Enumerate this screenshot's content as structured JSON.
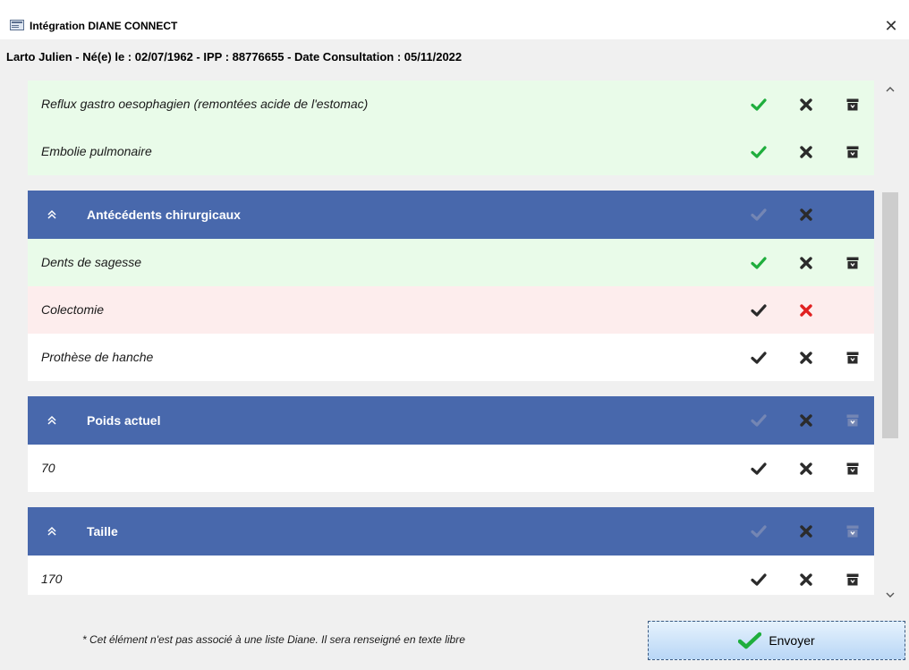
{
  "window": {
    "title": "Intégration DIANE CONNECT",
    "close_label": "✕"
  },
  "patient_line": "Larto  Julien - Né(e) le : 02/07/1962 - IPP : 88776655 - Date Consultation : 05/11/2022",
  "rows": [
    {
      "kind": "item",
      "state": "accepted",
      "label": "Reflux gastro oesophagien (remontées acide de l'estomac)"
    },
    {
      "kind": "item",
      "state": "accepted",
      "label": "Embolie pulmonaire"
    },
    {
      "kind": "section",
      "label": "Antécédents chirurgicaux"
    },
    {
      "kind": "item",
      "state": "accepted",
      "label": "Dents de sagesse"
    },
    {
      "kind": "item",
      "state": "rejected",
      "label": "Colectomie"
    },
    {
      "kind": "item",
      "state": "pending",
      "label": "Prothèse de hanche"
    },
    {
      "kind": "section",
      "label": "Poids actuel"
    },
    {
      "kind": "item",
      "state": "pending",
      "label": "70"
    },
    {
      "kind": "section",
      "label": "Taille"
    },
    {
      "kind": "item",
      "state": "pending",
      "label": "170"
    }
  ],
  "icons": {
    "check": "check-icon",
    "cross": "cross-icon",
    "archive": "archive-icon",
    "collapse": "double-chevron-up-icon"
  },
  "colors": {
    "section_header": "#4868ac",
    "accepted_bg": "#e9fbe9",
    "rejected_bg": "#fdeded",
    "check_green": "#1fae3d",
    "cross_red": "#e02020",
    "icon_dark": "#2b2b2b",
    "icon_header_dim": "#7486b4"
  },
  "footer": {
    "note": "* Cet élément n'est pas associé à une liste Diane. Il sera renseigné en texte libre",
    "send_label": "Envoyer"
  }
}
